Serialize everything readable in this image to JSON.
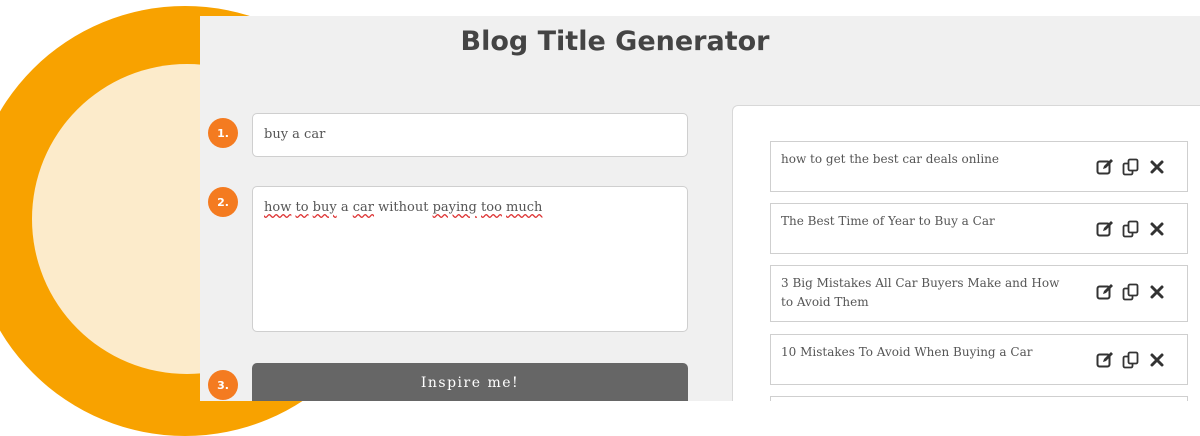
{
  "app": {
    "title": "Blog Title Generator"
  },
  "steps": [
    "1.",
    "2.",
    "3."
  ],
  "inputs": {
    "keyword": "buy a car",
    "description_words": [
      {
        "t": "how",
        "spell": true
      },
      {
        "t": " ",
        "spell": false
      },
      {
        "t": "to",
        "spell": true
      },
      {
        "t": " ",
        "spell": false
      },
      {
        "t": "buy",
        "spell": true
      },
      {
        "t": " ",
        "spell": false
      },
      {
        "t": "a",
        "spell": false
      },
      {
        "t": " ",
        "spell": false
      },
      {
        "t": "car",
        "spell": true
      },
      {
        "t": " without ",
        "spell": false
      },
      {
        "t": "paying",
        "spell": true
      },
      {
        "t": " ",
        "spell": false
      },
      {
        "t": "too",
        "spell": true
      },
      {
        "t": " ",
        "spell": false
      },
      {
        "t": "much",
        "spell": true
      }
    ]
  },
  "button": {
    "label": "Inspire me!"
  },
  "results": [
    {
      "text": "how to get the best car deals online"
    },
    {
      "text": "The Best Time of Year to Buy a Car"
    },
    {
      "text": "3 Big Mistakes All Car Buyers Make and How to Avoid Them"
    },
    {
      "text": "10 Mistakes To Avoid When Buying a Car"
    }
  ],
  "result_icons": [
    "edit-icon",
    "copy-icon",
    "delete-icon"
  ],
  "colors": {
    "accent": "#f47b20",
    "ring": "#f8a200",
    "ring_inner": "#fcebcb",
    "button": "#666666",
    "panel": "#f0f0f0"
  }
}
